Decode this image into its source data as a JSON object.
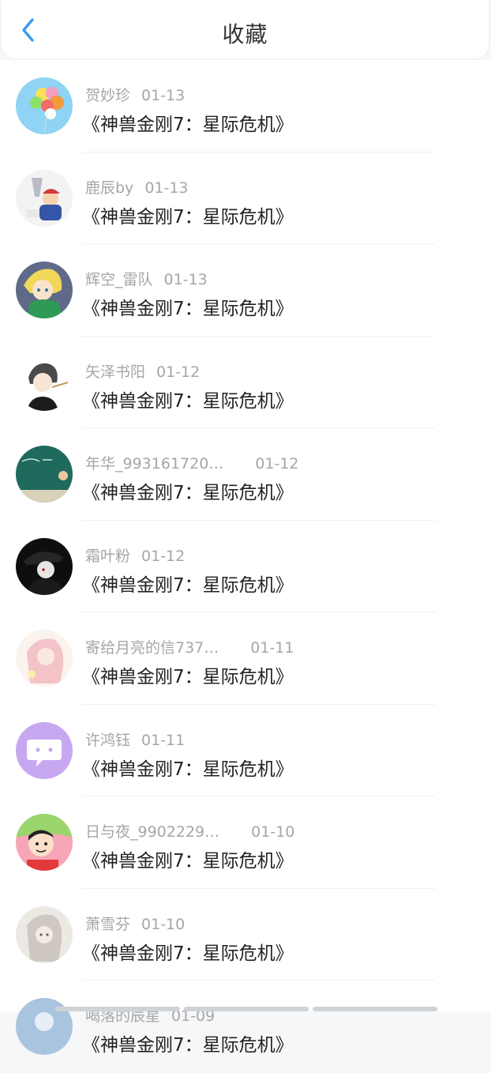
{
  "header": {
    "title": "收藏",
    "back_icon": "chevron-left-icon",
    "accent_color": "#3a9bf0"
  },
  "favorites": [
    {
      "user": "贺妙珍",
      "date": "01-13",
      "subject": "《神兽金刚7：星际危机》"
    },
    {
      "user": "鹿辰by",
      "date": "01-13",
      "subject": "《神兽金刚7：星际危机》"
    },
    {
      "user": "辉空_雷队",
      "date": "01-13",
      "subject": "《神兽金刚7：星际危机》"
    },
    {
      "user": "矢泽书阳",
      "date": "01-12",
      "subject": "《神兽金刚7：星际危机》"
    },
    {
      "user": "年华_993161720…",
      "date": "01-12",
      "subject": "《神兽金刚7：星际危机》"
    },
    {
      "user": "霜叶粉",
      "date": "01-12",
      "subject": "《神兽金刚7：星际危机》"
    },
    {
      "user": "寄给月亮的信737…",
      "date": "01-11",
      "subject": "《神兽金刚7：星际危机》"
    },
    {
      "user": "许鸿钰",
      "date": "01-11",
      "subject": "《神兽金刚7：星际危机》"
    },
    {
      "user": "日与夜_9902229…",
      "date": "01-10",
      "subject": "《神兽金刚7：星际危机》"
    },
    {
      "user": "萧雪芬",
      "date": "01-10",
      "subject": "《神兽金刚7：星际危机》"
    },
    {
      "user": "喝落的辰星",
      "date": "01-09",
      "subject": "《神兽金刚7：星际危机》"
    }
  ]
}
